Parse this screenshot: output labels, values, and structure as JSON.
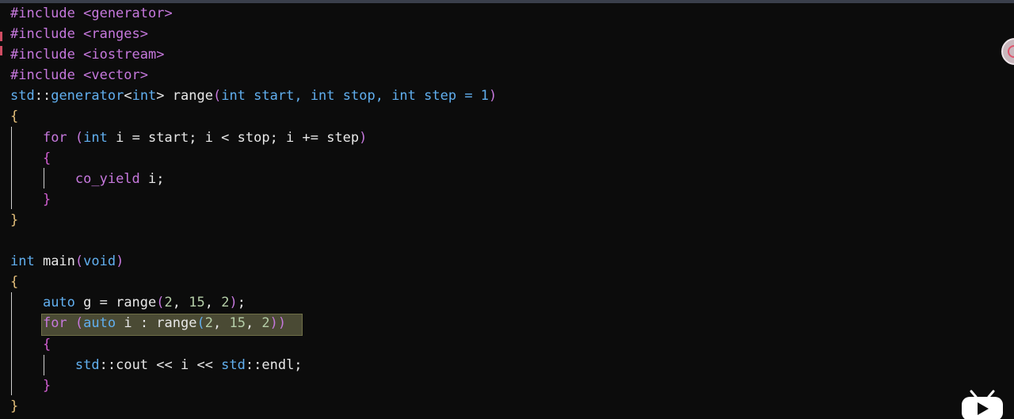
{
  "colors": {
    "background": "#0c0c0c",
    "default": "#e8e8e8",
    "keyword": "#c678dd",
    "type": "#61afef",
    "brace": "#e5c07b",
    "bracket2": "#d25fd2",
    "literal": "#b5cea8",
    "highlight_bg": "#4a4a34"
  },
  "code_lines": [
    [
      {
        "t": "#include <generator>",
        "c": "keyword"
      }
    ],
    [
      {
        "t": "#include <ranges>",
        "c": "keyword"
      }
    ],
    [
      {
        "t": "#include <iostream>",
        "c": "keyword"
      }
    ],
    [
      {
        "t": "#include <vector>",
        "c": "keyword"
      }
    ],
    [
      {
        "t": "std",
        "c": "type"
      },
      {
        "t": "::",
        "c": "default"
      },
      {
        "t": "generator",
        "c": "type"
      },
      {
        "t": "<",
        "c": "default"
      },
      {
        "t": "int",
        "c": "type"
      },
      {
        "t": "> range",
        "c": "default"
      },
      {
        "t": "(",
        "c": "keyword"
      },
      {
        "t": "int",
        "c": "type"
      },
      {
        "t": " start, ",
        "c": "type"
      },
      {
        "t": "int",
        "c": "type"
      },
      {
        "t": " stop, ",
        "c": "type"
      },
      {
        "t": "int",
        "c": "type"
      },
      {
        "t": " step = 1",
        "c": "type"
      },
      {
        "t": ")",
        "c": "keyword"
      }
    ],
    [
      {
        "t": "{",
        "c": "brace"
      }
    ],
    [
      {
        "t": "    ",
        "c": "default"
      },
      {
        "t": "for",
        "c": "keyword"
      },
      {
        "t": " (",
        "c": "keyword"
      },
      {
        "t": "int",
        "c": "type"
      },
      {
        "t": " i = start; i < stop; i += step",
        "c": "default"
      },
      {
        "t": ")",
        "c": "keyword"
      }
    ],
    [
      {
        "t": "    ",
        "c": "default"
      },
      {
        "t": "{",
        "c": "bracket2"
      }
    ],
    [
      {
        "t": "        ",
        "c": "default"
      },
      {
        "t": "co_yield",
        "c": "keyword"
      },
      {
        "t": " i;",
        "c": "default"
      }
    ],
    [
      {
        "t": "    ",
        "c": "default"
      },
      {
        "t": "}",
        "c": "bracket2"
      }
    ],
    [
      {
        "t": "}",
        "c": "brace"
      }
    ],
    [
      {
        "t": "",
        "c": "default"
      }
    ],
    [
      {
        "t": "int",
        "c": "type"
      },
      {
        "t": " main",
        "c": "default"
      },
      {
        "t": "(",
        "c": "keyword"
      },
      {
        "t": "void",
        "c": "type"
      },
      {
        "t": ")",
        "c": "keyword"
      }
    ],
    [
      {
        "t": "{",
        "c": "brace"
      }
    ],
    [
      {
        "t": "    ",
        "c": "default"
      },
      {
        "t": "auto",
        "c": "type"
      },
      {
        "t": " g = range",
        "c": "default"
      },
      {
        "t": "(",
        "c": "keyword"
      },
      {
        "t": "2",
        "c": "literal"
      },
      {
        "t": ", ",
        "c": "default"
      },
      {
        "t": "15",
        "c": "literal"
      },
      {
        "t": ", ",
        "c": "default"
      },
      {
        "t": "2",
        "c": "literal"
      },
      {
        "t": ")",
        "c": "keyword"
      },
      {
        "t": ";",
        "c": "default"
      }
    ],
    [
      {
        "t": "    ",
        "c": "default"
      },
      {
        "t": "for",
        "c": "keyword"
      },
      {
        "t": " (",
        "c": "keyword"
      },
      {
        "t": "auto",
        "c": "type"
      },
      {
        "t": " i : range",
        "c": "default"
      },
      {
        "t": "(",
        "c": "type"
      },
      {
        "t": "2",
        "c": "literal"
      },
      {
        "t": ", ",
        "c": "default"
      },
      {
        "t": "15",
        "c": "literal"
      },
      {
        "t": ", ",
        "c": "default"
      },
      {
        "t": "2",
        "c": "literal"
      },
      {
        "t": "))",
        "c": "keyword"
      }
    ],
    [
      {
        "t": "    ",
        "c": "default"
      },
      {
        "t": "{",
        "c": "bracket2"
      }
    ],
    [
      {
        "t": "        ",
        "c": "default"
      },
      {
        "t": "std",
        "c": "type"
      },
      {
        "t": "::",
        "c": "default"
      },
      {
        "t": "cout << i << ",
        "c": "default"
      },
      {
        "t": "std",
        "c": "type"
      },
      {
        "t": "::",
        "c": "default"
      },
      {
        "t": "endl;",
        "c": "default"
      }
    ],
    [
      {
        "t": "    ",
        "c": "default"
      },
      {
        "t": "}",
        "c": "bracket2"
      }
    ],
    [
      {
        "t": "}",
        "c": "brace"
      }
    ]
  ],
  "icons": {
    "floating_button": "floating-record-icon",
    "watermark": "bilibili-tv-logo"
  }
}
